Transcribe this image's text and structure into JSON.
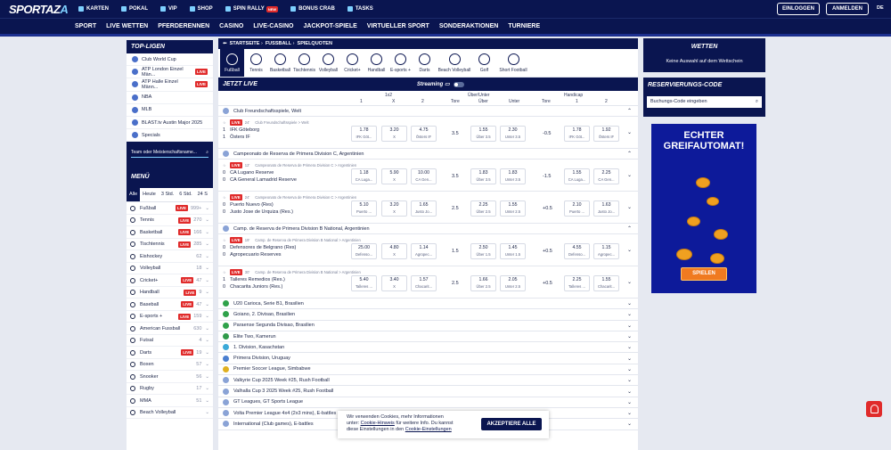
{
  "brand": {
    "logo_a": "SPORTAZ",
    "logo_b": "A"
  },
  "topnav": [
    {
      "label": "KARTEN"
    },
    {
      "label": "POKAL"
    },
    {
      "label": "VIP"
    },
    {
      "label": "SHOP"
    },
    {
      "label": "SPIN RALLY",
      "badge": "NEW"
    },
    {
      "label": "BONUS CRAB"
    },
    {
      "label": "TASKS"
    }
  ],
  "auth": {
    "login": "EINLOGGEN",
    "register": "ANMELDEN",
    "lang": "DE"
  },
  "mainnav": [
    "SPORT",
    "LIVE WETTEN",
    "PFERDERENNEN",
    "CASINO",
    "LIVE-CASINO",
    "JACKPOT-SPIELE",
    "VIRTUELLER SPORT",
    "SONDERAKTIONEN",
    "TURNIERE"
  ],
  "left": {
    "top_title": "TOP-LIGEN",
    "top": [
      {
        "label": "Club World Cup",
        "live": false
      },
      {
        "label": "ATP London Einzel Män...",
        "live": true
      },
      {
        "label": "ATP Halle Einzel Männ...",
        "live": true
      },
      {
        "label": "NBA",
        "live": false
      },
      {
        "label": "MLB",
        "live": false
      },
      {
        "label": "BLAST.tv Austin Major 2025",
        "live": false
      },
      {
        "label": "Specials",
        "live": false
      }
    ],
    "search_placeholder": "Team oder Meisterschaftsname...",
    "menu_title": "MENÜ",
    "tabs": [
      "Alle",
      "Heute",
      "3 Std.",
      "6 Std.",
      "24 S"
    ],
    "live_label": "LIVE",
    "sports": [
      {
        "label": "Fußball",
        "live": true,
        "count": "999+"
      },
      {
        "label": "Tennis",
        "live": true,
        "count": "270"
      },
      {
        "label": "Basketball",
        "live": true,
        "count": "166"
      },
      {
        "label": "Tischtennis",
        "live": true,
        "count": "285"
      },
      {
        "label": "Eishockey",
        "live": false,
        "count": "62"
      },
      {
        "label": "Volleyball",
        "live": false,
        "count": "18"
      },
      {
        "label": "Cricket+",
        "live": true,
        "count": "47"
      },
      {
        "label": "Handball",
        "live": true,
        "count": "9"
      },
      {
        "label": "Baseball",
        "live": true,
        "count": "47"
      },
      {
        "label": "E-sports +",
        "live": true,
        "count": "159"
      },
      {
        "label": "American Fussball",
        "live": false,
        "count": "630"
      },
      {
        "label": "Futsal",
        "live": false,
        "count": "4"
      },
      {
        "label": "Darts",
        "live": true,
        "count": "19"
      },
      {
        "label": "Boxen",
        "live": false,
        "count": "57"
      },
      {
        "label": "Snooker",
        "live": false,
        "count": "56"
      },
      {
        "label": "Rugby",
        "live": false,
        "count": "17"
      },
      {
        "label": "MMA",
        "live": false,
        "count": "51"
      },
      {
        "label": "Beach Volleyball",
        "live": false,
        "count": ""
      }
    ]
  },
  "content": {
    "breadcrumb": [
      "STARTSEITE",
      "FUSSBALL",
      "SPIELQUOTEN"
    ],
    "sports_bar": [
      "Fußball",
      "Tennis",
      "Basketball",
      "Tischtennis",
      "Volleyball",
      "Cricket+",
      "Handball",
      "E-sports +",
      "Darts",
      "Beach Volleyball",
      "Golf",
      "Short Football"
    ],
    "jetzt_live": "JETZT LIVE",
    "streaming": "Streaming",
    "col_headers": {
      "g1": "1x2",
      "c1": "1",
      "cx": "X",
      "c2": "2",
      "tore": "Tore",
      "g2": "Über/Unter",
      "ueber": "Über",
      "unter": "Unter",
      "g3": "Handicap",
      "h1": "1",
      "h2": "2"
    },
    "blocks": [
      {
        "league": "Club Freundschaftsspiele, Welt",
        "matches": [
          {
            "min": "24'",
            "meta": "Club Freundschaftsspiele > Welt",
            "s1": "1",
            "s2": "1",
            "t1": "IFK Göteborg",
            "t2": "Östers IF",
            "odds": [
              {
                "o": "1.78",
                "l": "IFK Göt..."
              },
              {
                "o": "3.20",
                "l": "X"
              },
              {
                "o": "4.75",
                "l": "Östers IF"
              }
            ],
            "tore": "3.5",
            "ou": [
              {
                "o": "1.55",
                "l": "Über 3.5"
              },
              {
                "o": "2.30",
                "l": "Unter 3.5"
              }
            ],
            "hc": "-0.5",
            "h": [
              {
                "o": "1.78",
                "l": "IFK Göt..."
              },
              {
                "o": "1.92",
                "l": "Östers IF"
              }
            ]
          }
        ]
      },
      {
        "league": "Campeonato de Reserva de Primera Division C, Argentinien",
        "matches": [
          {
            "min": "12'",
            "meta": "Campeonato de Reserva de Primera Division C > Argentinien",
            "s1": "0",
            "s2": "0",
            "t1": "CA Lugano Reserve",
            "t2": "CA General Lamadrid Reserve",
            "odds": [
              {
                "o": "1.18",
                "l": "CA Luga..."
              },
              {
                "o": "5.90",
                "l": "X"
              },
              {
                "o": "10.00",
                "l": "CA Gen..."
              }
            ],
            "tore": "3.5",
            "ou": [
              {
                "o": "1.83",
                "l": "Über 3.5"
              },
              {
                "o": "1.83",
                "l": "Unter 3.5"
              }
            ],
            "hc": "-1.5",
            "h": [
              {
                "o": "1.55",
                "l": "CA Luga..."
              },
              {
                "o": "2.25",
                "l": "CA Gen..."
              }
            ]
          },
          {
            "min": "24'",
            "meta": "Campeonato de Reserva de Primera Division C > Argentinien",
            "s1": "0",
            "s2": "0",
            "t1": "Puerto Nuevo (Res)",
            "t2": "Justo Jose de Urquiza (Res.)",
            "odds": [
              {
                "o": "5.10",
                "l": "Puerto ..."
              },
              {
                "o": "3.20",
                "l": "X"
              },
              {
                "o": "1.65",
                "l": "Justo Jo..."
              }
            ],
            "tore": "2.5",
            "ou": [
              {
                "o": "2.25",
                "l": "Über 2.5"
              },
              {
                "o": "1.55",
                "l": "Unter 2.5"
              }
            ],
            "hc": "+0.5",
            "h": [
              {
                "o": "2.10",
                "l": "Puerto ..."
              },
              {
                "o": "1.63",
                "l": "Justo Jo..."
              }
            ]
          }
        ]
      },
      {
        "league": "Camp. de Reserva de Primera Division B National, Argentinien",
        "matches": [
          {
            "min": "19'",
            "meta": "Camp. de Reserva de Primera Division B National > Argentinien",
            "s1": "0",
            "s2": "0",
            "t1": "Defensores de Belgrano (Res)",
            "t2": "Agropecuario Reserves",
            "odds": [
              {
                "o": "25.00",
                "l": "Defenso..."
              },
              {
                "o": "4.80",
                "l": "X"
              },
              {
                "o": "1.14",
                "l": "Agropec..."
              }
            ],
            "tore": "1.5",
            "ou": [
              {
                "o": "2.50",
                "l": "Über 1.5"
              },
              {
                "o": "1.45",
                "l": "Unter 1.5"
              }
            ],
            "hc": "+0.5",
            "h": [
              {
                "o": "4.55",
                "l": "Defenso..."
              },
              {
                "o": "1.15",
                "l": "Agropec..."
              }
            ]
          },
          {
            "min": "30'",
            "meta": "Camp. de Reserva de Primera Division B National > Argentinien",
            "s1": "1",
            "s2": "0",
            "t1": "Talleres Remedios (Res.)",
            "t2": "Chacarita Juniors (Res.)",
            "odds": [
              {
                "o": "5.40",
                "l": "Talleres ..."
              },
              {
                "o": "3.40",
                "l": "X"
              },
              {
                "o": "1.57",
                "l": "Chacarit..."
              }
            ],
            "tore": "2.5",
            "ou": [
              {
                "o": "1.66",
                "l": "Über 2.5"
              },
              {
                "o": "2.05",
                "l": "Unter 2.5"
              }
            ],
            "hc": "+0.5",
            "h": [
              {
                "o": "2.25",
                "l": "Talleres ..."
              },
              {
                "o": "1.55",
                "l": "Chacarit..."
              }
            ]
          }
        ]
      }
    ],
    "leagues": [
      {
        "label": "U20 Carioca, Serie B1, Brasilien",
        "flag": "#2fa24a"
      },
      {
        "label": "Goiano, 2. Divisao, Brasilien",
        "flag": "#2fa24a"
      },
      {
        "label": "Paraense Segunda Divisao, Brasilien",
        "flag": "#2fa24a"
      },
      {
        "label": "Elite Two, Kamerun",
        "flag": "#2f9a4a"
      },
      {
        "label": "1. Division, Kasachstan",
        "flag": "#3aa9d8"
      },
      {
        "label": "Primera Division, Uruguay",
        "flag": "#4a7fd0"
      },
      {
        "label": "Premier Soccer League, Simbabwe",
        "flag": "#e0b020"
      },
      {
        "label": "Valkyrie Cup 2025 Week #25, Rush Football",
        "flag": "#8aa3d6"
      },
      {
        "label": "Valhalla Cup 3 2025 Week #25, Rush Football",
        "flag": "#8aa3d6"
      },
      {
        "label": "GT Leagues, GT Sports League",
        "flag": "#8aa3d6"
      },
      {
        "label": "Volta Premier League 4x4 (2x3 mins), E-battles",
        "flag": "#8aa3d6"
      },
      {
        "label": "International (Club games), E-battles",
        "flag": "#8aa3d6"
      }
    ]
  },
  "right": {
    "wetten_title": "WETTEN",
    "wetten_text": "Keine Auswahl auf dem Wettschein",
    "res_title": "RESERVIERUNGS-CODE",
    "res_placeholder": "Buchungs-Code eingeben"
  },
  "banner": {
    "title": "ECHTER GREIFAUTOMAT!",
    "cta": "SPIELEN"
  },
  "cookie": {
    "line1": "Wir verwenden Cookies, mehr Informationen",
    "line2a": "unter: ",
    "link1": "Cookie-Hinweis",
    "line2b": " für weitere Info. Du kannst",
    "line3a": "diese Einstellungen in den ",
    "link2": "Cookie-Einstellungen",
    "accept": "AKZEPTIERE ALLE"
  }
}
